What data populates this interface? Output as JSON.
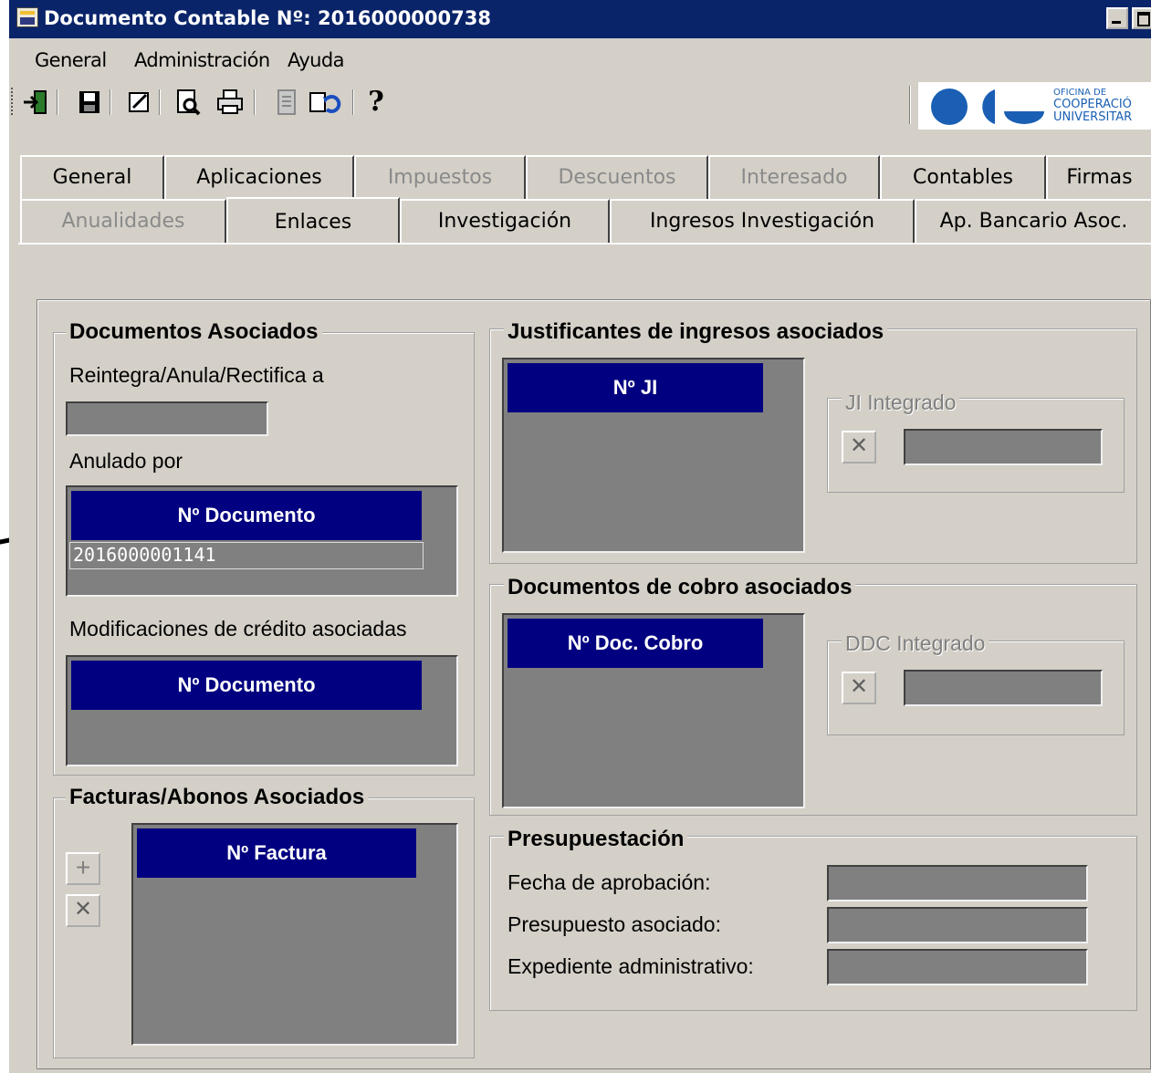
{
  "window": {
    "title": "Documento Contable Nº: 2016000000738"
  },
  "menu": [
    "General",
    "Administración",
    "Ayuda"
  ],
  "toolbar": {
    "icons": [
      "exit-icon",
      "save-icon",
      "edit-icon",
      "preview-icon",
      "print-icon",
      "document-icon",
      "refresh-icon",
      "help-icon"
    ],
    "help_glyph": "?"
  },
  "logo": {
    "line1": "OFICINA DE",
    "line2": "COOPERACIÓ",
    "line3": "UNIVERSITAR",
    "color": "#1a5fb4"
  },
  "tabs": {
    "row1": [
      {
        "label": "General",
        "enabled": true
      },
      {
        "label": "Aplicaciones",
        "enabled": true
      },
      {
        "label": "Impuestos",
        "enabled": false
      },
      {
        "label": "Descuentos",
        "enabled": false
      },
      {
        "label": "Interesado",
        "enabled": false
      },
      {
        "label": "Contables",
        "enabled": true
      },
      {
        "label": "Firmas",
        "enabled": true
      }
    ],
    "row2": [
      {
        "label": "Anualidades",
        "enabled": false
      },
      {
        "label": "Enlaces",
        "enabled": true,
        "active": true
      },
      {
        "label": "Investigación",
        "enabled": true
      },
      {
        "label": "Ingresos Investigación",
        "enabled": true
      },
      {
        "label": "Ap. Bancario Asoc.",
        "enabled": true
      }
    ]
  },
  "documentos_asociados": {
    "title": "Documentos Asociados",
    "reintegra_label": "Reintegra/Anula/Rectifica a",
    "reintegra_value": "",
    "anulado_label": "Anulado por",
    "anulado_grid": {
      "header": "Nº Documento",
      "rows": [
        "2016000001141"
      ]
    },
    "modificaciones_label": "Modificaciones de crédito asociadas",
    "modificaciones_grid": {
      "header": "Nº Documento",
      "rows": []
    }
  },
  "facturas": {
    "title": "Facturas/Abonos Asociados",
    "grid": {
      "header": "Nº Factura",
      "rows": []
    },
    "add_glyph": "+",
    "remove_glyph": "✕"
  },
  "justificantes": {
    "title": "Justificantes de ingresos asociados",
    "grid": {
      "header": "Nº JI",
      "rows": []
    },
    "integrado_title": "JI Integrado",
    "integrado_value": "",
    "clear_glyph": "✕"
  },
  "cobro": {
    "title": "Documentos de cobro asociados",
    "grid": {
      "header": "Nº Doc. Cobro",
      "rows": []
    },
    "integrado_title": "DDC Integrado",
    "integrado_value": "",
    "clear_glyph": "✕"
  },
  "presupuestacion": {
    "title": "Presupuestación",
    "fields": [
      {
        "label": "Fecha de aprobación:",
        "value": ""
      },
      {
        "label": "Presupuesto asociado:",
        "value": ""
      },
      {
        "label": "Expediente administrativo:",
        "value": ""
      }
    ]
  },
  "colors": {
    "titlebar": "#0a246a",
    "grid_header": "#000080",
    "grid_bg": "#808080",
    "face": "#d4d0c8"
  }
}
